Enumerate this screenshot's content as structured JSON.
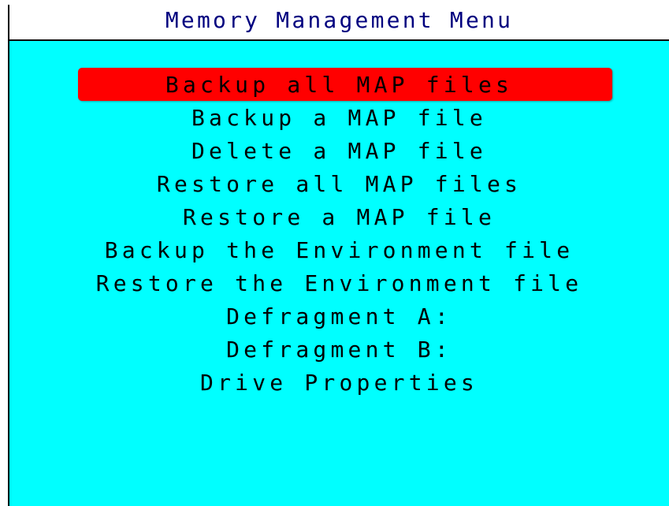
{
  "title": "Memory Management Menu",
  "colors": {
    "background": "#00ffff",
    "title_background": "#ffffff",
    "title_text": "#00007f",
    "selected_background": "#ff0000",
    "item_text": "#000000"
  },
  "menu": {
    "selected_index": 0,
    "items": [
      "Backup all MAP files",
      "Backup a MAP file",
      "Delete a MAP file",
      "Restore all MAP files",
      "Restore a MAP file",
      "Backup the Environment file",
      "Restore the Environment file",
      "Defragment A:",
      "Defragment B:",
      "Drive Properties"
    ]
  }
}
